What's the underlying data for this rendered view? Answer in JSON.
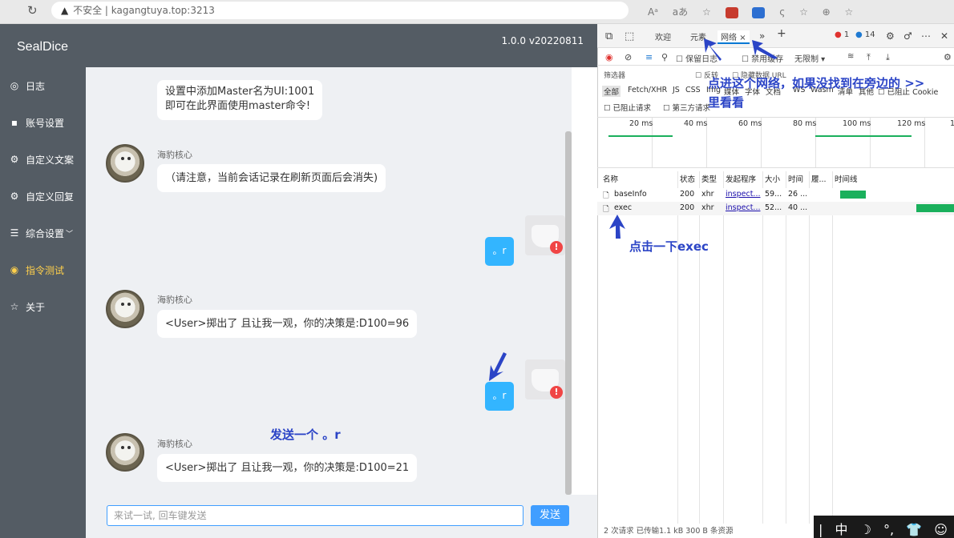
{
  "browser": {
    "warning": "不安全",
    "url": "kagangtuya.top:3213",
    "tool_a": "Aᵃ",
    "tool_b": "aあ",
    "tool_c": "☆",
    "tool_d": "ς",
    "tool_e": "☆",
    "tool_f": "⊕",
    "tool_g": "☆"
  },
  "app": {
    "brand": "SealDice",
    "version": "1.0.0 v20220811"
  },
  "sidebar": {
    "items": [
      {
        "label": "日志",
        "icon": "◎"
      },
      {
        "label": "账号设置",
        "icon": "▪"
      },
      {
        "label": "自定义文案",
        "icon": "⚙"
      },
      {
        "label": "自定义回复",
        "icon": "⚙"
      },
      {
        "label": "综合设置",
        "icon": "☰",
        "arrow": "﹀"
      },
      {
        "label": "指令测试",
        "icon": "◉"
      },
      {
        "label": "关于",
        "icon": "☆"
      }
    ]
  },
  "chat": {
    "messages": [
      {
        "sender": "",
        "lines": [
          "设置中添加Master名为UI:1001",
          "即可在此界面使用master命令!"
        ]
      },
      {
        "sender": "海豹核心",
        "text": "（请注意，当前会话记录在刷新页面后会消失)"
      },
      {
        "user_text": "。r"
      },
      {
        "sender": "海豹核心",
        "text": "<User>掷出了 且让我一观，你的决策是:D100=96"
      },
      {
        "user_text": "。r"
      },
      {
        "sender": "海豹核心",
        "text": "<User>掷出了 且让我一观，你的决策是:D100=21"
      }
    ],
    "badge": "!",
    "input_placeholder": "来试一试, 回车键发送",
    "send_label": "发送"
  },
  "devtools": {
    "tabs": {
      "welcome": "欢迎",
      "elements": "元素",
      "network": "网络",
      "close": "×",
      "more": "»",
      "add": "+"
    },
    "counts": {
      "errors": "1",
      "warnings": "14"
    },
    "toolbar": {
      "preserve": "保留日志",
      "disable_cache": "禁用缓存",
      "throttle": "无限制"
    },
    "filter": {
      "placeholder": "筛选器",
      "invert": "反转",
      "hide_data": "隐藏数据 URL"
    },
    "types": [
      "全部",
      "Fetch/XHR",
      "JS",
      "CSS",
      "Img",
      "媒体",
      "字体",
      "文档",
      "WS",
      "Wasm",
      "清单",
      "其他"
    ],
    "blocked_cookies": "已阻止 Cookie",
    "blocked_requests": "已阻止请求",
    "third_party": "第三方请求",
    "timeline_ticks": [
      "20 ms",
      "40 ms",
      "60 ms",
      "80 ms",
      "100 ms",
      "120 ms",
      "1"
    ],
    "columns": [
      "名称",
      "状态",
      "类型",
      "发起程序",
      "大小",
      "时间",
      "履...",
      "时间线"
    ],
    "rows": [
      {
        "name": "baseInfo",
        "status": "200",
        "type": "xhr",
        "initiator": "inspect...",
        "size": "59...",
        "time": "26 ..."
      },
      {
        "name": "exec",
        "status": "200",
        "type": "xhr",
        "initiator": "inspect...",
        "size": "52...",
        "time": "40 ..."
      }
    ],
    "status": "2 次请求  已传输1.1 kB  300 B 条资源"
  },
  "ime": {
    "items": [
      "中",
      "☽",
      "°,",
      "👕",
      "☺",
      "⚙"
    ]
  },
  "annotations": {
    "network_hint_1": "点进这个网络，如果没找到在旁边的 >>",
    "network_hint_2": "里看看",
    "exec_hint": "点击一下exec",
    "send_hint": "发送一个 。r"
  },
  "colors": {
    "sidebar": "#545c64",
    "active": "#ffd04b",
    "primary": "#409eff",
    "user_bubble": "#33b5ff",
    "annotation": "#2b44c6"
  }
}
